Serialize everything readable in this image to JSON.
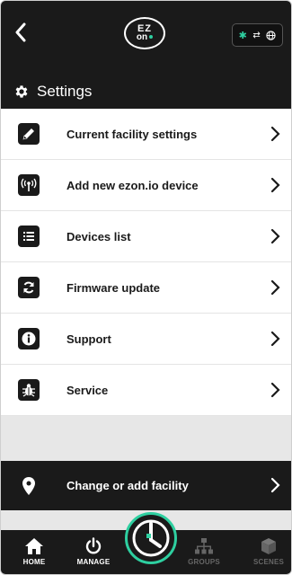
{
  "topbar": {
    "logo_line1": "EZ",
    "logo_line2": "on",
    "connection": {
      "bluetooth_icon": "bluetooth-icon",
      "link_icon": "arrows-icon",
      "globe_icon": "globe-icon"
    }
  },
  "header": {
    "title": "Settings",
    "icon": "gear-icon"
  },
  "menu": {
    "items": [
      {
        "label": "Current facility settings",
        "icon": "pencil-icon"
      },
      {
        "label": "Add new ezon.io device",
        "icon": "antenna-icon"
      },
      {
        "label": "Devices list",
        "icon": "list-icon"
      },
      {
        "label": "Firmware update",
        "icon": "refresh-icon"
      },
      {
        "label": "Support",
        "icon": "info-icon"
      },
      {
        "label": "Service",
        "icon": "bug-icon"
      }
    ]
  },
  "facility": {
    "label": "Change or add facility",
    "icon": "location-pin-icon"
  },
  "nav": {
    "home": "HOME",
    "manage": "MANAGE",
    "groups": "GROUPS",
    "scenes": "SCENES"
  },
  "colors": {
    "accent": "#2ecfa0",
    "bar": "#1a1a1a",
    "band": "#e7e7e7"
  }
}
